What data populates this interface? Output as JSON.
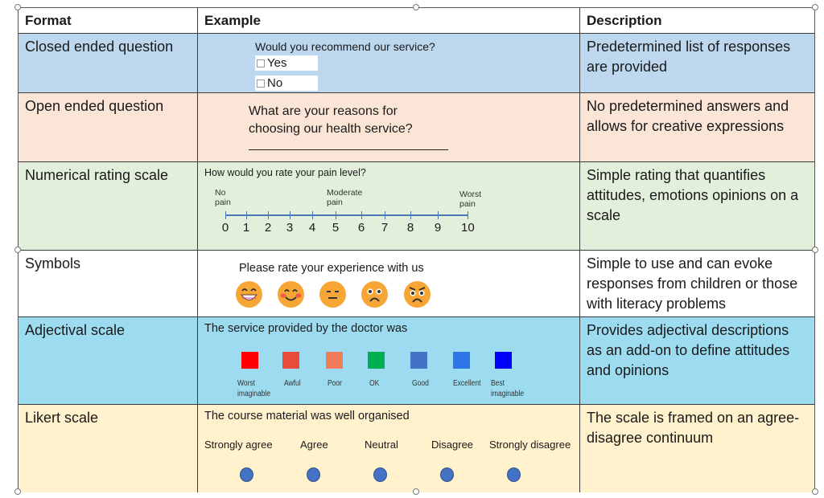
{
  "table": {
    "headers": {
      "format": "Format",
      "example": "Example",
      "description": "Description"
    },
    "rows": [
      {
        "format": "Closed ended question",
        "description": "Predetermined list of responses are provided",
        "color": "#bdd7ee",
        "example": {
          "question": "Would you recommend our service?",
          "options": [
            "Yes",
            "No"
          ]
        }
      },
      {
        "format": "Open ended question",
        "description": "No predetermined answers and allows for creative expressions",
        "color": "#fbe5d6",
        "example": {
          "question_line1": "What are your reasons for",
          "question_line2": "choosing our health service?",
          "answer_line": "______________________________"
        }
      },
      {
        "format": "Numerical rating scale",
        "description": "Simple rating that quantifies attitudes, emotions opinions on a scale",
        "color": "#e2efda",
        "example": {
          "question": "How would you rate your pain level?",
          "anchors": [
            {
              "line1": "No",
              "line2": "pain",
              "value": 0
            },
            {
              "line1": "Moderate",
              "line2": "pain",
              "value": 5
            },
            {
              "line1": "Worst",
              "line2": "pain",
              "value": 10
            }
          ],
          "ticks": [
            "0",
            "1",
            "2",
            "3",
            "4",
            "5",
            "6",
            "7",
            "8",
            "9",
            "10"
          ]
        }
      },
      {
        "format": "Symbols",
        "description": "Simple to use and can evoke responses from children or those with literacy problems",
        "color": "#ffffff",
        "example": {
          "question": "Please rate your experience with us",
          "faces": [
            "grinning-face",
            "smiling-blushing-face",
            "expressionless-face",
            "frowning-face",
            "angry-face"
          ]
        }
      },
      {
        "format": "Adjectival scale",
        "description": "Provides adjectival descriptions as an add-on to define attitudes and opinions",
        "color": "#9ddcf0",
        "example": {
          "question": "The service provided by the doctor was",
          "options": [
            {
              "line1": "Worst",
              "line2": "imaginable",
              "color": "#ff0000"
            },
            {
              "line1": "Awful",
              "line2": "",
              "color": "#e84c3d"
            },
            {
              "line1": "Poor",
              "line2": "",
              "color": "#f07c5a"
            },
            {
              "line1": "OK",
              "line2": "",
              "color": "#00b050"
            },
            {
              "line1": "Good",
              "line2": "",
              "color": "#4472c4"
            },
            {
              "line1": "Excellent",
              "line2": "",
              "color": "#2e75e6"
            },
            {
              "line1": "Best",
              "line2": "imaginable",
              "color": "#0000ff"
            }
          ]
        }
      },
      {
        "format": "Likert scale",
        "description": "The scale is framed on an agree-disagree continuum",
        "color": "#fff2cc",
        "example": {
          "question": "The course material was well organised",
          "options": [
            "Strongly agree",
            "Agree",
            "Neutral",
            "Disagree",
            "Strongly disagree"
          ],
          "dot_color": "#4472c4"
        }
      }
    ]
  }
}
